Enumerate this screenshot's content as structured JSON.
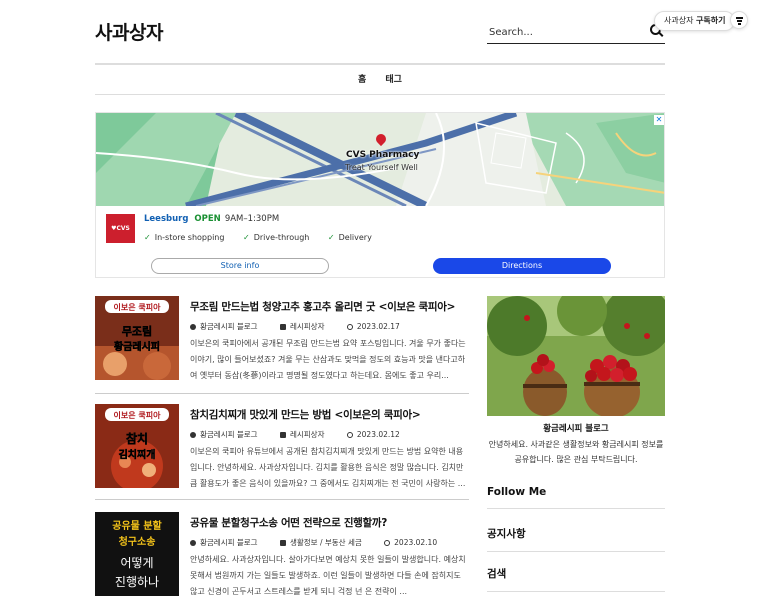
{
  "header": {
    "site_title": "사과상자",
    "search_placeholder": "Search...",
    "subscribe_prefix": "사과상자",
    "subscribe_label": "구독하기"
  },
  "nav": {
    "items": [
      "홈",
      "태그"
    ]
  },
  "ad": {
    "pin_title": "CVS Pharmacy",
    "pin_subtitle": "Treat Yourself Well",
    "logo_text": "♥CVS",
    "location": "Leesburg",
    "status": "OPEN",
    "hours": "9AM–1:30PM",
    "features": [
      "In-store shopping",
      "Drive-through",
      "Delivery"
    ],
    "store_info_label": "Store info",
    "directions_label": "Directions",
    "close_label": "✕"
  },
  "posts": [
    {
      "thumb_line1": "이보은 쿡피아",
      "thumb_line2": "무조림",
      "thumb_line3": "황금레시피",
      "title": "무조림 만드는법 청양고추 홍고추 올리면 굿 <이보은 쿡피아>",
      "author": "황금레시피 블로그",
      "category": "레시피상자",
      "date": "2023.02.17",
      "excerpt": "이보은의 쿡피아에서 공개된 무조림 만드는법 요약 포스팅입니다. 겨울 무가 좋다는 이야기, 많이 들어보셨죠? 겨울 무는 산삼과도 맞먹을 정도의 효능과 맛을 낸다고하여 옛부터 동삼(冬蔘)이라고 명명될 정도였다고 하는데요. 몸에도 좋고 우리..."
    },
    {
      "thumb_line1": "이보은 쿡피아",
      "thumb_line2": "참치",
      "thumb_line3": "김치찌개",
      "title": "참치김치찌개 맛있게 만드는 방법 <이보은의 쿡피아>",
      "author": "황금레시피 블로그",
      "category": "레시피상자",
      "date": "2023.02.12",
      "excerpt": "이보은의 쿡피아 유튜브에서 공개된 참치김치찌개 맛있게 만드는 방법 요약한 내용입니다. 안녕하세요. 사과상자입니다. 김치를 활용한 음식은 정말 많습니다. 김치만큼 활용도가 좋은 음식이 있을까요? 그 중에서도 김치찌개는 전 국민이 사랑하는 ..."
    },
    {
      "thumb_line1": "공유물 분할",
      "thumb_line2": "청구소송",
      "thumb_line3": "어떻게",
      "thumb_line4": "진행하나",
      "title": "공유물 분할청구소송 어떤 전략으로 진행할까?",
      "author": "황금레시피 블로그",
      "category": "생활정보 / 부동산 세금",
      "date": "2023.02.10",
      "excerpt": "안녕하세요. 사과상자입니다. 살아가다보면 예상치 못한 일들이 발생합니다. 예상치 못해서 법원까지 가는 일들도 발생하죠. 이런 일들이 발생하면 다들 손에 잡히지도 않고 신경이 곤두서고 스트레스를 받게 되니 걱정 넌 은 전략이 ..."
    }
  ],
  "sidebar": {
    "blog_name": "황금레시피 블로그",
    "blog_desc": "안녕하세요. 사과같은 생활정보와 황금레시피 정보를 공유합니다. 많은 관심 부탁드립니다.",
    "follow_heading": "Follow Me",
    "notice_heading": "공지사항",
    "search_heading": "검색"
  },
  "colors": {
    "accent_blue": "#1a48e8",
    "link_blue": "#1160b3",
    "open_green": "#1a9033",
    "cvs_red": "#cc1f2d"
  }
}
